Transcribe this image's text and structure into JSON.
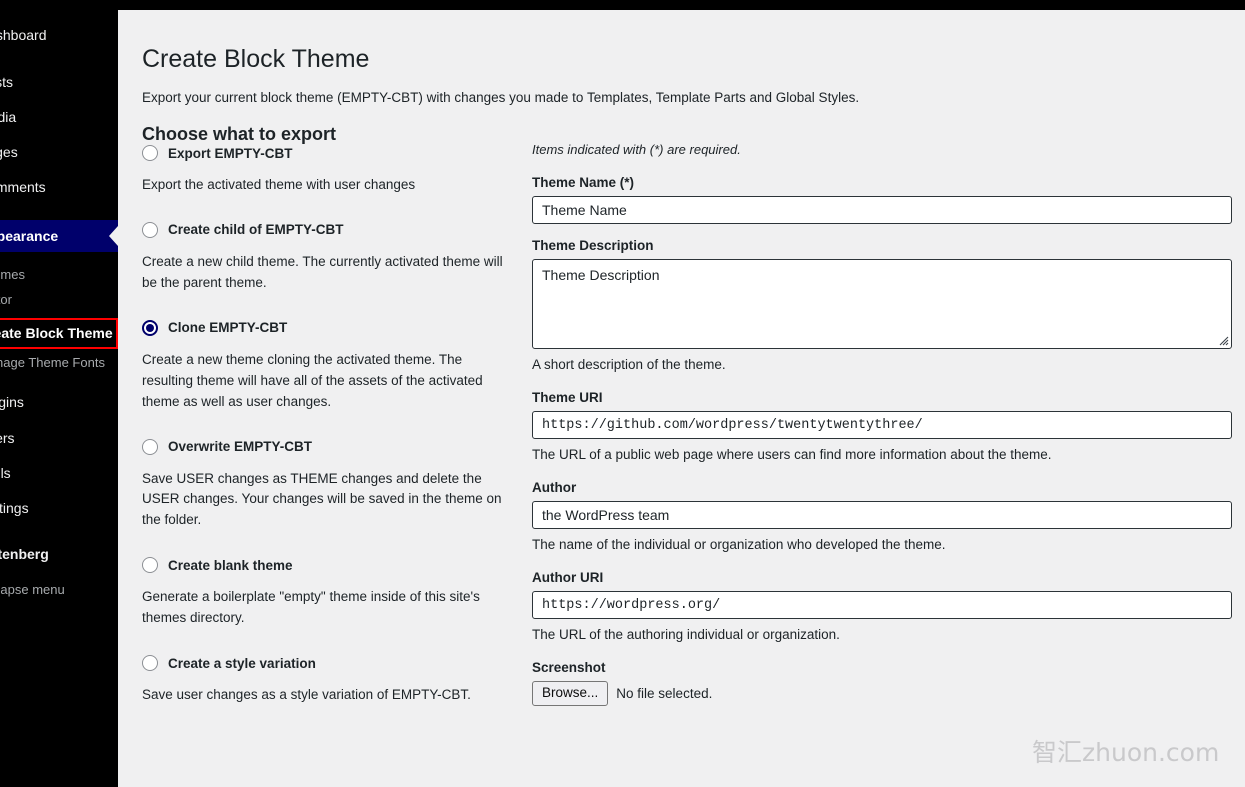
{
  "admin_bar": {
    "present": true,
    "color": "#000000"
  },
  "sidebar": {
    "background": "#000000",
    "active_color": "#00006b",
    "highlight_outline_color": "#ff0000",
    "items": [
      {
        "label": "Dashboard",
        "name": "dashboard",
        "current": false
      },
      {
        "label": "Posts",
        "name": "posts",
        "current": false
      },
      {
        "label": "Media",
        "name": "media",
        "current": false
      },
      {
        "label": "Pages",
        "name": "pages",
        "current": false
      },
      {
        "label": "Comments",
        "name": "comments",
        "current": false
      },
      {
        "label": "Appearance",
        "name": "appearance",
        "current": true
      },
      {
        "label": "Plugins",
        "name": "plugins",
        "current": false
      },
      {
        "label": "Users",
        "name": "users",
        "current": false
      },
      {
        "label": "Tools",
        "name": "tools",
        "current": false
      },
      {
        "label": "Settings",
        "name": "settings",
        "current": false
      },
      {
        "label": "Gutenberg",
        "name": "gutenberg",
        "current": false
      }
    ],
    "submenu": [
      {
        "label": "Themes",
        "name": "themes",
        "highlighted": false
      },
      {
        "label": "Editor",
        "name": "editor",
        "highlighted": false
      },
      {
        "label": "Create Block Theme",
        "name": "create-block-theme",
        "highlighted": true
      },
      {
        "label": "Manage Theme Fonts",
        "name": "manage-theme-fonts",
        "highlighted": false
      }
    ],
    "collapse_label": "Collapse menu"
  },
  "page": {
    "title": "Create Block Theme",
    "intro": "Export your current block theme (EMPTY-CBT) with changes you made to Templates, Template Parts and Global Styles.",
    "choose_heading": "Choose what to export"
  },
  "export_options": [
    {
      "label": "Export EMPTY-CBT",
      "name": "export-empty-cbt",
      "checked": false,
      "description": "Export the activated theme with user changes"
    },
    {
      "label": "Create child of EMPTY-CBT",
      "name": "create-child-of-empty-cbt",
      "checked": false,
      "description": "Create a new child theme. The currently activated theme will be the parent theme."
    },
    {
      "label": "Clone EMPTY-CBT",
      "name": "clone-empty-cbt",
      "checked": true,
      "description": "Create a new theme cloning the activated theme. The resulting theme will have all of the assets of the activated theme as well as user changes."
    },
    {
      "label": "Overwrite EMPTY-CBT",
      "name": "overwrite-empty-cbt",
      "checked": false,
      "description": "Save USER changes as THEME changes and delete the USER changes. Your changes will be saved in the theme on the folder."
    },
    {
      "label": "Create blank theme",
      "name": "create-blank-theme",
      "checked": false,
      "description": "Generate a boilerplate \"empty\" theme inside of this site's themes directory."
    },
    {
      "label": "Create a style variation",
      "name": "create-a-style-variation",
      "checked": false,
      "description": "Save user changes as a style variation of EMPTY-CBT."
    }
  ],
  "form": {
    "required_note": "Items indicated with (*) are required.",
    "theme_name": {
      "label": "Theme Name (*)",
      "value": "Theme Name",
      "placeholder": "Theme Name"
    },
    "theme_description": {
      "label": "Theme Description",
      "value": "Theme Description",
      "placeholder": "Theme Description",
      "help": "A short description of the theme."
    },
    "theme_uri": {
      "label": "Theme URI",
      "value": "https://github.com/wordpress/twentytwentythree/",
      "help": "The URL of a public web page where users can find more information about the theme."
    },
    "author": {
      "label": "Author",
      "value": "the WordPress team",
      "help": "The name of the individual or organization who developed the theme."
    },
    "author_uri": {
      "label": "Author URI",
      "value": "https://wordpress.org/",
      "help": "The URL of the authoring individual or organization."
    },
    "screenshot": {
      "label": "Screenshot",
      "browse_label": "Browse...",
      "no_file_text": "No file selected."
    }
  },
  "watermark": {
    "cjk": "智汇",
    "latin": "zhuon.com"
  }
}
